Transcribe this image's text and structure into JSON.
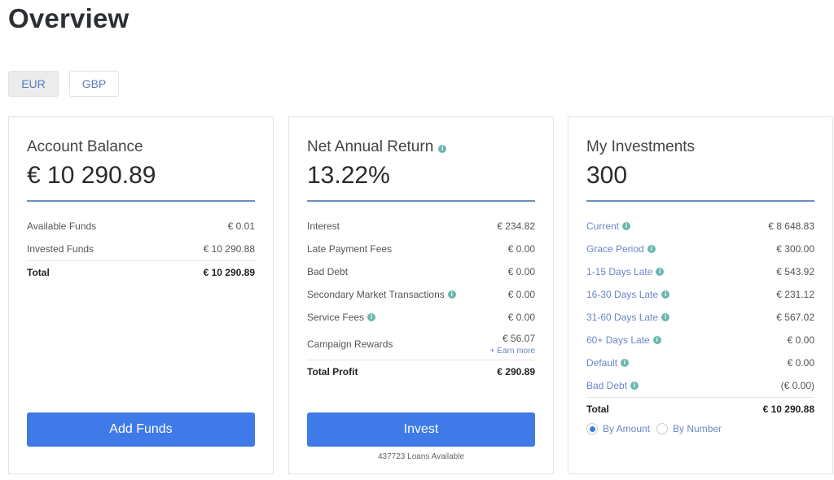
{
  "page": {
    "title": "Overview"
  },
  "currency": {
    "options": [
      "EUR",
      "GBP"
    ],
    "selected": "EUR"
  },
  "account_balance": {
    "heading": "Account Balance",
    "amount": "€ 10 290.89",
    "rows": [
      {
        "label": "Available Funds",
        "value": "€ 0.01"
      },
      {
        "label": "Invested Funds",
        "value": "€ 10 290.88"
      }
    ],
    "total": {
      "label": "Total",
      "value": "€ 10 290.89"
    },
    "button": "Add Funds"
  },
  "net_annual_return": {
    "heading": "Net Annual Return",
    "amount": "13.22%",
    "rows": [
      {
        "label": "Interest",
        "value": "€ 234.82"
      },
      {
        "label": "Late Payment Fees",
        "value": "€ 0.00"
      },
      {
        "label": "Bad Debt",
        "value": "€ 0.00"
      },
      {
        "label": "Secondary Market Transactions",
        "value": "€ 0.00"
      },
      {
        "label": "Service Fees",
        "value": "€ 0.00"
      },
      {
        "label": "Campaign Rewards",
        "value": "€ 56.07",
        "link": "+ Earn more"
      }
    ],
    "total": {
      "label": "Total Profit",
      "value": "€ 290.89"
    },
    "button": "Invest",
    "loans_available": "437723 Loans Available"
  },
  "my_investments": {
    "heading": "My Investments",
    "amount": "300",
    "rows": [
      {
        "label": "Current",
        "value": "€ 8 648.83"
      },
      {
        "label": "Grace Period",
        "value": "€ 300.00"
      },
      {
        "label": "1-15 Days Late",
        "value": "€ 543.92"
      },
      {
        "label": "16-30 Days Late",
        "value": "€ 231.12"
      },
      {
        "label": "31-60 Days Late",
        "value": "€ 567.02"
      },
      {
        "label": "60+ Days Late",
        "value": "€ 0.00"
      },
      {
        "label": "Default",
        "value": "€ 0.00"
      },
      {
        "label": "Bad Debt",
        "value": "(€ 0.00)"
      }
    ],
    "total": {
      "label": "Total",
      "value": "€ 10 290.88"
    },
    "view_options": [
      {
        "label": "By Amount",
        "selected": true
      },
      {
        "label": "By Number",
        "selected": false
      }
    ]
  },
  "icons": {
    "info": "info-icon"
  },
  "colors": {
    "accent": "#3f7ae8",
    "link": "#6b86c8",
    "info": "#6bb7b0",
    "rule": "#6b8fbf"
  }
}
